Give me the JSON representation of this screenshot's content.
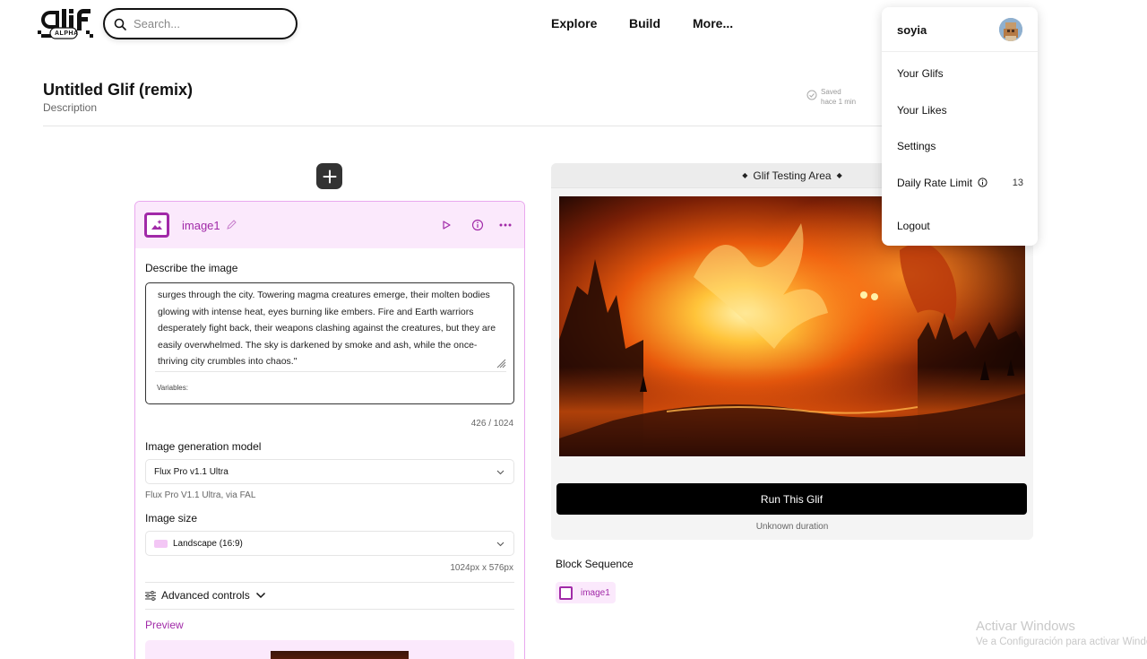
{
  "header": {
    "logo_text": "gli",
    "logo_badge": "ALPHA",
    "search_placeholder": "Search...",
    "nav": [
      "Explore",
      "Build",
      "More..."
    ]
  },
  "page": {
    "title": "Untitled Glif (remix)",
    "description": "Description",
    "saved_label": "Saved",
    "saved_time": "hace 1 min"
  },
  "block": {
    "name": "image1",
    "prompt_label": "Describe the image",
    "prompt_text": "surges through the city. Towering magma creatures emerge, their molten bodies glowing with intense heat, eyes burning like embers. Fire and Earth warriors desperately fight back, their weapons clashing against the creatures, but they are easily overwhelmed. The sky is darkened by smoke and ash, while the once-thriving city crumbles into chaos.\"",
    "variables_label": "Variables:",
    "char_count": "426 / 1024",
    "model_label": "Image generation model",
    "model_value": "Flux Pro v1.1 Ultra",
    "model_note": "Flux Pro V1.1 Ultra, via FAL",
    "size_label": "Image size",
    "size_value": "Landscape (16:9)",
    "size_dims": "1024px x 576px",
    "advanced_label": "Advanced controls",
    "preview_label": "Preview"
  },
  "testing": {
    "title": "Glif Testing Area",
    "run_label": "Run This Glif",
    "duration": "Unknown duration",
    "sequence_label": "Block Sequence",
    "sequence_items": [
      "image1"
    ]
  },
  "menu": {
    "username": "soyia",
    "items": [
      "Your Glifs",
      "Your Likes",
      "Settings",
      "Daily Rate Limit",
      "Logout"
    ],
    "rate_limit_value": "13"
  },
  "watermark": {
    "line1": "Activar Windows",
    "line2": "Ve a Configuración para activar Windows."
  },
  "colors": {
    "accent": "#a12aa8",
    "accent_bg": "#fbe9fc",
    "run_button": "#000000"
  }
}
